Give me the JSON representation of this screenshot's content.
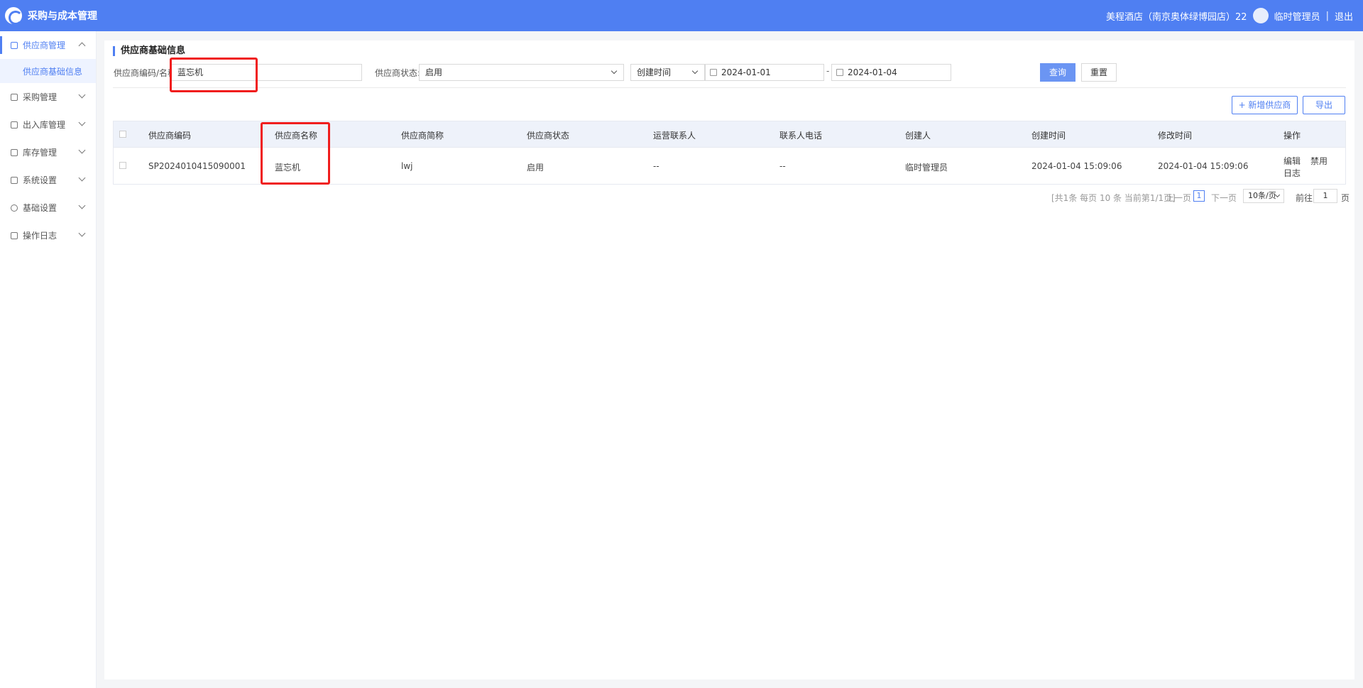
{
  "app": {
    "title": "采购与成本管理"
  },
  "header": {
    "store": "美程酒店（南京奥体绿博园店）22",
    "user": "临时管理员",
    "separator": "|",
    "logout": "退出"
  },
  "sidebar": {
    "items": [
      {
        "label": "供应商管理",
        "active": true,
        "open": true
      },
      {
        "label": "采购管理"
      },
      {
        "label": "出入库管理"
      },
      {
        "label": "库存管理"
      },
      {
        "label": "系统设置"
      },
      {
        "label": "基础设置"
      },
      {
        "label": "操作日志"
      }
    ],
    "sub_item": "供应商基础信息"
  },
  "page": {
    "title": "供应商基础信息"
  },
  "filters": {
    "code_name_label": "供应商编码/名称:",
    "code_name_value": "蓝忘机",
    "status_label": "供应商状态:",
    "status_value": "启用",
    "time_type": "创建时间",
    "date_from": "2024-01-01",
    "date_sep": "-",
    "date_to": "2024-01-04",
    "search_btn": "查询",
    "reset_btn": "重置"
  },
  "actions": {
    "add_btn": "+ 新增供应商",
    "export_btn": "导出"
  },
  "table": {
    "columns": [
      "供应商编码",
      "供应商名称",
      "供应商简称",
      "供应商状态",
      "运营联系人",
      "联系人电话",
      "创建人",
      "创建时间",
      "修改时间",
      "操作"
    ],
    "rows": [
      {
        "code": "SP2024010415090001",
        "name": "蓝忘机",
        "short": "lwj",
        "status": "启用",
        "contact": "--",
        "phone": "--",
        "creator": "临时管理员",
        "created": "2024-01-04 15:09:06",
        "modified": "2024-01-04 15:09:06",
        "op_edit": "编辑",
        "op_disable": "禁用",
        "op_log": "日志"
      }
    ]
  },
  "pagination": {
    "summary": "[共1条 每页 10 条 当前第1/1页]",
    "prev": "上一页",
    "current": "1",
    "next": "下一页",
    "page_size": "10条/页",
    "goto_label": "前往",
    "goto_value": "1",
    "page_unit": "页"
  }
}
